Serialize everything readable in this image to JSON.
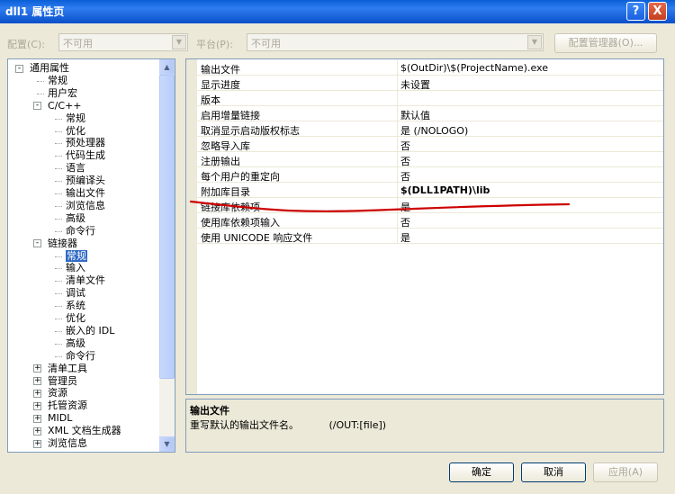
{
  "window": {
    "title": "dll1 属性页",
    "help_icon": "?",
    "close_icon": "X"
  },
  "config_bar": {
    "config_label": "配置(C):",
    "config_value": "不可用",
    "platform_label": "平台(P):",
    "platform_value": "不可用",
    "config_manager_label": "配置管理器(O)..."
  },
  "tree": {
    "items": [
      {
        "label": "通用属性",
        "depth": 0,
        "expander": "-"
      },
      {
        "label": "常规",
        "depth": 1
      },
      {
        "label": "用户宏",
        "depth": 1
      },
      {
        "label": "C/C++",
        "depth": 1,
        "expander": "-"
      },
      {
        "label": "常规",
        "depth": 2
      },
      {
        "label": "优化",
        "depth": 2
      },
      {
        "label": "预处理器",
        "depth": 2
      },
      {
        "label": "代码生成",
        "depth": 2
      },
      {
        "label": "语言",
        "depth": 2
      },
      {
        "label": "预编译头",
        "depth": 2
      },
      {
        "label": "输出文件",
        "depth": 2
      },
      {
        "label": "浏览信息",
        "depth": 2
      },
      {
        "label": "高级",
        "depth": 2
      },
      {
        "label": "命令行",
        "depth": 2
      },
      {
        "label": "链接器",
        "depth": 1,
        "expander": "-"
      },
      {
        "label": "常规",
        "depth": 2,
        "selected": true
      },
      {
        "label": "输入",
        "depth": 2
      },
      {
        "label": "清单文件",
        "depth": 2
      },
      {
        "label": "调试",
        "depth": 2
      },
      {
        "label": "系统",
        "depth": 2
      },
      {
        "label": "优化",
        "depth": 2
      },
      {
        "label": "嵌入的 IDL",
        "depth": 2
      },
      {
        "label": "高级",
        "depth": 2
      },
      {
        "label": "命令行",
        "depth": 2
      },
      {
        "label": "清单工具",
        "depth": 1,
        "expander": "+"
      },
      {
        "label": "管理员",
        "depth": 1,
        "expander": "+"
      },
      {
        "label": "资源",
        "depth": 1,
        "expander": "+"
      },
      {
        "label": "托管资源",
        "depth": 1,
        "expander": "+"
      },
      {
        "label": "MIDL",
        "depth": 1,
        "expander": "+"
      },
      {
        "label": "XML 文档生成器",
        "depth": 1,
        "expander": "+"
      },
      {
        "label": "浏览信息",
        "depth": 1,
        "expander": "+"
      }
    ]
  },
  "properties": [
    {
      "name": "输出文件",
      "value": "$(OutDir)\\$(ProjectName).exe"
    },
    {
      "name": "显示进度",
      "value": "未设置"
    },
    {
      "name": "版本",
      "value": ""
    },
    {
      "name": "启用增量链接",
      "value": "默认值"
    },
    {
      "name": "取消显示启动版权标志",
      "value": "是 (/NOLOGO)"
    },
    {
      "name": "忽略导入库",
      "value": "否"
    },
    {
      "name": "注册输出",
      "value": "否"
    },
    {
      "name": "每个用户的重定向",
      "value": "否"
    },
    {
      "name": "附加库目录",
      "value": "$(DLL1PATH)\\lib",
      "bold": true
    },
    {
      "name": "链接库依赖项",
      "value": "是"
    },
    {
      "name": "使用库依赖项输入",
      "value": "否"
    },
    {
      "name": "使用 UNICODE 响应文件",
      "value": "是"
    }
  ],
  "description": {
    "title": "输出文件",
    "text": "重写默认的输出文件名。",
    "switch": "(/OUT:[file])"
  },
  "buttons": {
    "ok": "确定",
    "cancel": "取消",
    "apply": "应用(A)"
  },
  "annotation": {
    "color": "#cc0000"
  }
}
